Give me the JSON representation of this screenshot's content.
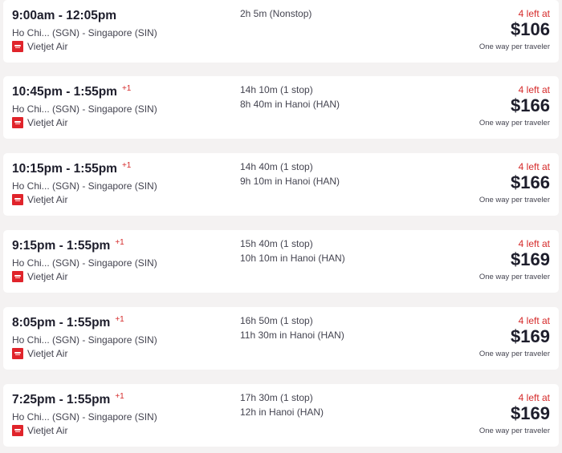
{
  "flights": [
    {
      "times": "9:00am - 12:05pm",
      "day_offset": "",
      "route": "Ho Chi... (SGN) - Singapore (SIN)",
      "airline": "Vietjet Air",
      "airline_icon": "vietjet-logo-icon",
      "duration": "2h 5m (Nonstop)",
      "layover": "",
      "seats_left": "4 left at",
      "price": "$106",
      "price_basis": "One way per traveler"
    },
    {
      "times": "10:45pm - 1:55pm",
      "day_offset": "+1",
      "route": "Ho Chi... (SGN) - Singapore (SIN)",
      "airline": "Vietjet Air",
      "airline_icon": "vietjet-logo-icon",
      "duration": "14h 10m (1 stop)",
      "layover": "8h 40m in Hanoi (HAN)",
      "seats_left": "4 left at",
      "price": "$166",
      "price_basis": "One way per traveler"
    },
    {
      "times": "10:15pm - 1:55pm",
      "day_offset": "+1",
      "route": "Ho Chi... (SGN) - Singapore (SIN)",
      "airline": "Vietjet Air",
      "airline_icon": "vietjet-logo-icon",
      "duration": "14h 40m (1 stop)",
      "layover": "9h 10m in Hanoi (HAN)",
      "seats_left": "4 left at",
      "price": "$166",
      "price_basis": "One way per traveler"
    },
    {
      "times": "9:15pm - 1:55pm",
      "day_offset": "+1",
      "route": "Ho Chi... (SGN) - Singapore (SIN)",
      "airline": "Vietjet Air",
      "airline_icon": "vietjet-logo-icon",
      "duration": "15h 40m (1 stop)",
      "layover": "10h 10m in Hanoi (HAN)",
      "seats_left": "4 left at",
      "price": "$169",
      "price_basis": "One way per traveler"
    },
    {
      "times": "8:05pm - 1:55pm",
      "day_offset": "+1",
      "route": "Ho Chi... (SGN) - Singapore (SIN)",
      "airline": "Vietjet Air",
      "airline_icon": "vietjet-logo-icon",
      "duration": "16h 50m (1 stop)",
      "layover": "11h 30m in Hanoi (HAN)",
      "seats_left": "4 left at",
      "price": "$169",
      "price_basis": "One way per traveler"
    },
    {
      "times": "7:25pm - 1:55pm",
      "day_offset": "+1",
      "route": "Ho Chi... (SGN) - Singapore (SIN)",
      "airline": "Vietjet Air",
      "airline_icon": "vietjet-logo-icon",
      "duration": "17h 30m (1 stop)",
      "layover": "12h in Hanoi (HAN)",
      "seats_left": "4 left at",
      "price": "$169",
      "price_basis": "One way per traveler"
    }
  ],
  "colors": {
    "page_background": "#f4f2f2",
    "card_background": "#ffffff",
    "accent_red": "#d52a2a",
    "text_primary": "#1d1d2b",
    "text_secondary": "#444450",
    "airline_logo": "#e0242b"
  }
}
